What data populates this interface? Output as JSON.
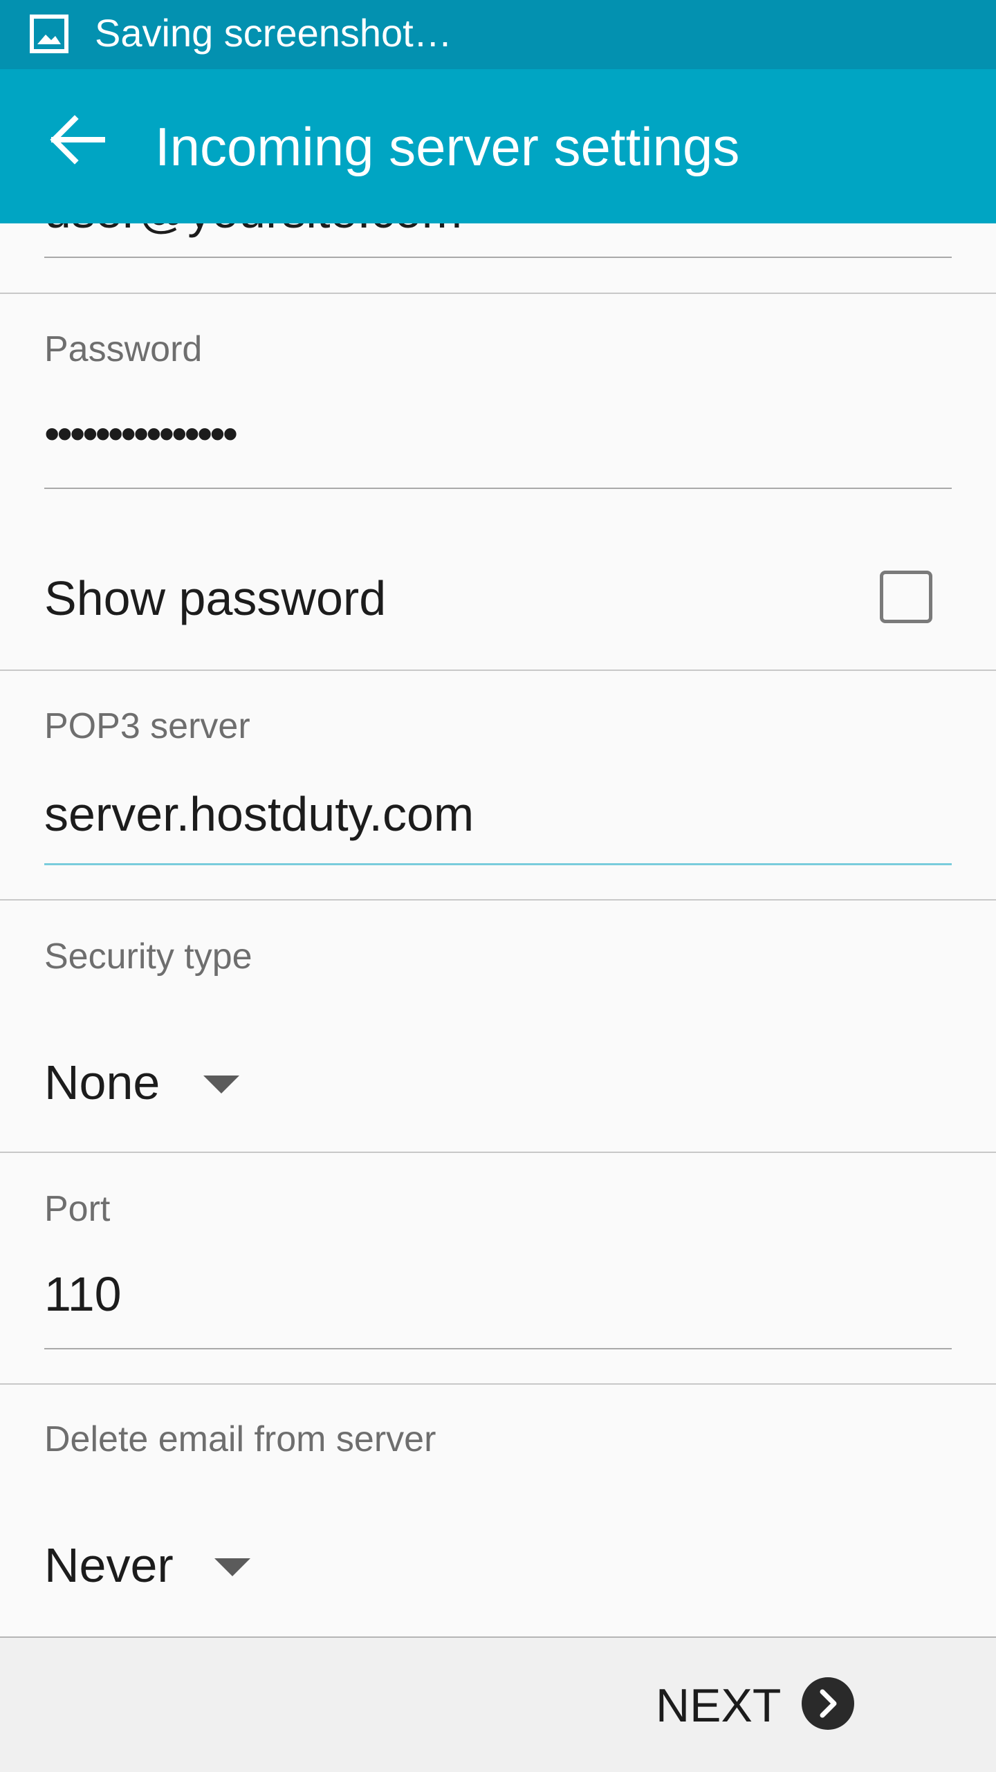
{
  "status_bar": {
    "notification_icon": "image-icon",
    "notification_text": "Saving screenshot…"
  },
  "app_bar": {
    "back_icon": "arrow-left-icon",
    "title": "Incoming server settings"
  },
  "form": {
    "username": {
      "value": "user@yoursite.com"
    },
    "password": {
      "label": "Password",
      "value": "•••••••••••••••"
    },
    "show_password": {
      "label": "Show password",
      "checked": false
    },
    "pop3_server": {
      "label": "POP3 server",
      "value": "server.hostduty.com"
    },
    "security_type": {
      "label": "Security type",
      "value": "None"
    },
    "port": {
      "label": "Port",
      "value": "110"
    },
    "delete_email": {
      "label": "Delete email from server",
      "value": "Never"
    }
  },
  "bottom_bar": {
    "next_label": "NEXT",
    "next_icon": "chevron-right-circle-icon"
  },
  "colors": {
    "status_bar": "#0391b0",
    "app_bar": "#00a5c3",
    "focused_underline": "#79ccdc"
  }
}
